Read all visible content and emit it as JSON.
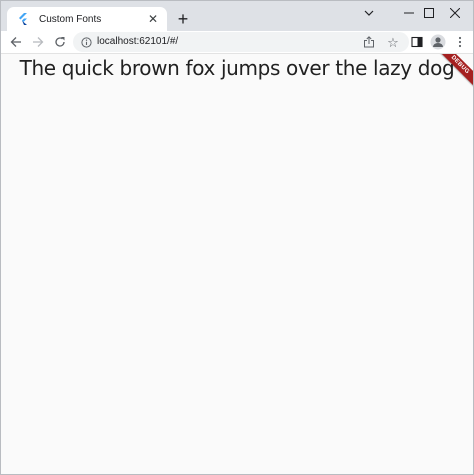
{
  "browser": {
    "tab": {
      "title": "Custom Fonts"
    },
    "address_bar": {
      "url": "localhost:62101/#/"
    }
  },
  "page": {
    "headline": "The quick brown fox jumps over the lazy dog",
    "debug_banner": "DEBUG"
  },
  "colors": {
    "tab_strip": "#dee1e6",
    "page_background": "#fafafa",
    "debug_banner": "#a52020"
  }
}
